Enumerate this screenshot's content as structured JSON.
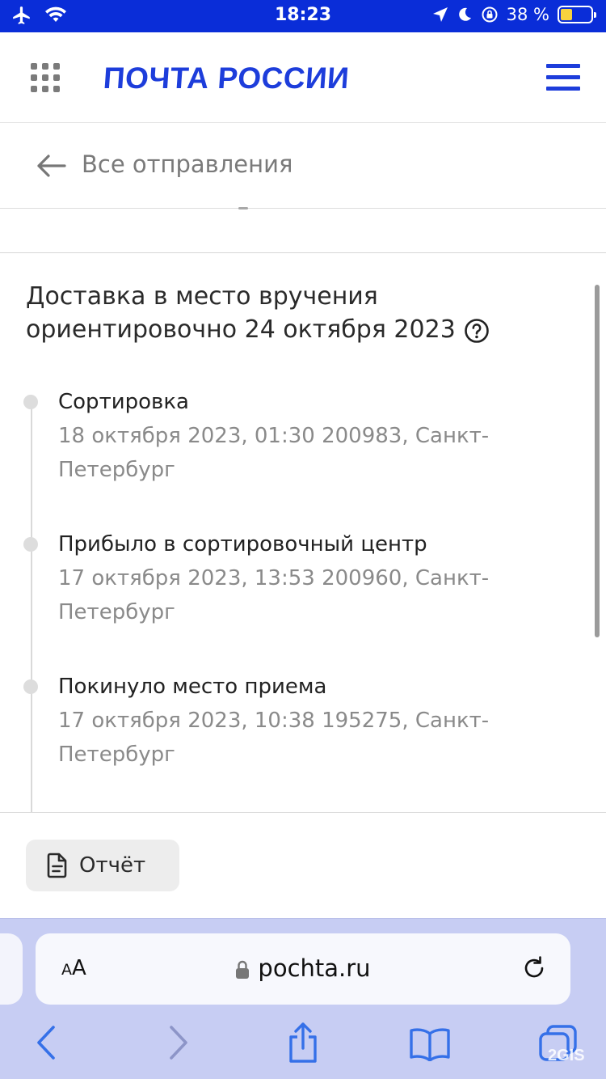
{
  "status_bar": {
    "time": "18:23",
    "battery_percent": "38 %",
    "battery_level": 0.38,
    "icons": [
      "airplane-icon",
      "wifi-icon",
      "location-icon",
      "moon-icon",
      "rotation-lock-icon",
      "battery-icon"
    ]
  },
  "header": {
    "logo_text": "ПОЧТА РОССИИ",
    "brand_color": "#1d3ddb",
    "icons": [
      "apps-grid-icon",
      "hamburger-menu-icon"
    ]
  },
  "back": {
    "label": "Все отправления",
    "icon": "arrow-left-icon"
  },
  "delivery": {
    "line1": "Доставка в место вручения",
    "line2": "ориентировочно 24 октября 2023",
    "help_icon": "question-circle-icon"
  },
  "events": [
    {
      "title": "Сортировка",
      "meta_line1": "18 октября 2023, 01:30 200983, Санкт-",
      "meta_line2": "Петербург"
    },
    {
      "title": "Прибыло в сортировочный центр",
      "meta_line1": "17 октября 2023, 13:53 200960, Санкт-",
      "meta_line2": "Петербург"
    },
    {
      "title": "Покинуло место приема",
      "meta_line1": "17 октября 2023, 10:38 195275, Санкт-",
      "meta_line2": "Петербург"
    }
  ],
  "report": {
    "label": "Отчёт",
    "icon": "document-icon"
  },
  "browser": {
    "aa_small": "A",
    "aa_large": "A",
    "url": "pochta.ru",
    "toolbar_color": "#c7cdf3",
    "nav_color": "#3570e8",
    "icons": [
      "lock-icon",
      "reload-icon",
      "back-icon",
      "forward-icon",
      "share-icon",
      "bookmarks-icon",
      "tabs-icon"
    ]
  },
  "watermark": "2GIS"
}
